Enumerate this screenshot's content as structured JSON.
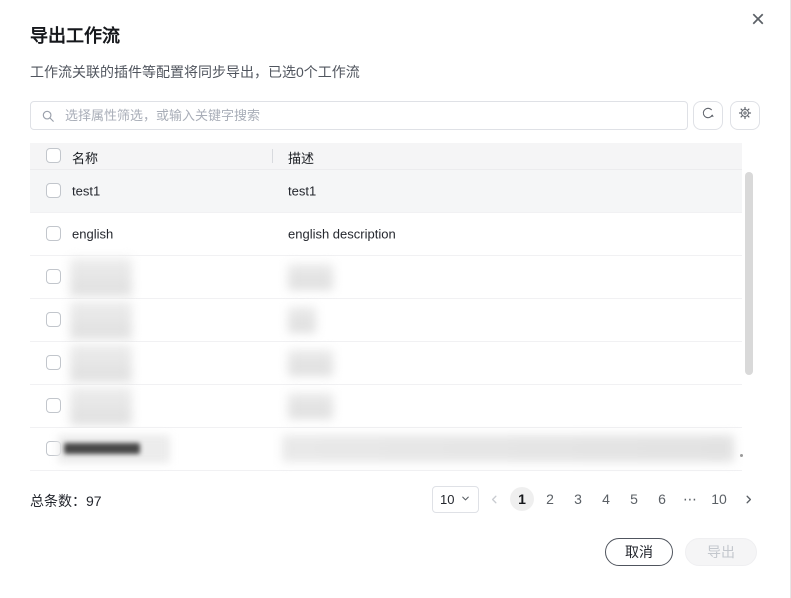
{
  "dialog": {
    "title": "导出工作流",
    "subtitle": "工作流关联的插件等配置将同步导出，已选0个工作流",
    "close_glyph": "×"
  },
  "search": {
    "placeholder": "选择属性筛选，或输入关键字搜索",
    "value": ""
  },
  "icons": {
    "search": "magnifier",
    "refresh": "circular-refresh-arrow",
    "settings": "gear",
    "close": "x-mark",
    "page_size_chevron": "chevron-down",
    "prev": "chevron-left",
    "next": "chevron-right"
  },
  "table": {
    "columns": {
      "name": "名称",
      "desc": "描述"
    },
    "rows": [
      {
        "name": "test1",
        "desc": "test1",
        "selected": false,
        "highlighted": true
      },
      {
        "name": "english",
        "desc": "english description",
        "selected": false
      },
      {
        "redacted": true,
        "selected": false
      },
      {
        "redacted": true,
        "selected": false
      },
      {
        "redacted": true,
        "selected": false
      },
      {
        "redacted": true,
        "selected": false
      },
      {
        "redacted": true,
        "selected": false
      }
    ],
    "select_all_checked": false
  },
  "pagination": {
    "total_label": "总条数：",
    "total_value": "97",
    "page_size": "10",
    "pages": [
      "1",
      "2",
      "3",
      "4",
      "5",
      "6",
      "⋯",
      "10"
    ],
    "active_page": "1"
  },
  "footer": {
    "cancel": "取消",
    "export": "导出",
    "export_disabled": true
  },
  "colors": {
    "header_bg": "#f5f5f6",
    "row_highlight": "#f5f6f7",
    "border": "#dfe1e6",
    "primary_text": "#16181c",
    "secondary_text": "#50555e",
    "disabled_text": "#c3c7cd",
    "scrollbar": "#d9d9d9"
  }
}
